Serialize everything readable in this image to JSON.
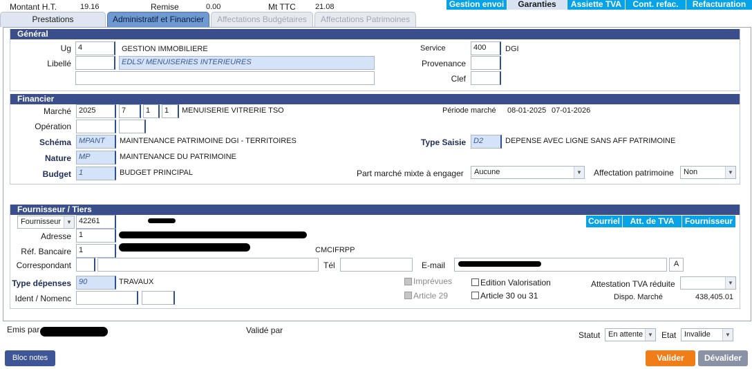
{
  "header": {
    "montant_ht_label": "Montant H.T.",
    "montant_ht_value": "19.16",
    "remise_label": "Remise",
    "remise_value": "0.00",
    "mt_ttc_label": "Mt TTC",
    "mt_ttc_value": "21.08",
    "top_buttons": [
      "Gestion envoi",
      "Garanties",
      "Assiette TVA",
      "Cont. refac.",
      "Refacturation"
    ]
  },
  "tabs": [
    "Prestations",
    "Administratif et Financier",
    "Affectations Budgétaires",
    "Affectations Patrimoines"
  ],
  "general": {
    "title": "Général",
    "ug_label": "Ug",
    "ug_value": "4",
    "ug_text": "GESTION IMMOBILIERE",
    "service_label": "Service",
    "service_value": "400",
    "service_text": "DGI",
    "libelle_label": "Libellé",
    "libelle_value": "EDLS/ MENUISERIES INTERIEURES",
    "provenance_label": "Provenance",
    "clef_label": "Clef"
  },
  "financier": {
    "title": "Financier",
    "marche_label": "Marché",
    "marche_year": "2025",
    "marche_n1": "7",
    "marche_n2": "1",
    "marche_n3": "1",
    "marche_text": "MENUISERIE VITRERIE TSO",
    "periode_label": "Période marché",
    "periode_start": "08-01-2025",
    "periode_end": "07-01-2026",
    "operation_label": "Opération",
    "schema_label": "Schéma",
    "schema_value": "MPANT",
    "schema_text": "MAINTENANCE PATRIMOINE DGI - TERRITOIRES",
    "type_saisie_label": "Type Saisie",
    "type_saisie_value": "D2",
    "type_saisie_text": "DEPENSE AVEC LIGNE SANS AFF PATRIMOINE",
    "nature_label": "Nature",
    "nature_value": "MP",
    "nature_text": "MAINTENANCE DU PATRIMOINE",
    "budget_label": "Budget",
    "budget_value": "1",
    "budget_text": "BUDGET PRINCIPAL",
    "part_marche_label": "Part marché mixte à engager",
    "part_marche_value": "Aucune",
    "affectation_label": "Affectation patrimoine",
    "affectation_value": "Non"
  },
  "fournisseur": {
    "title": "Fournisseur / Tiers",
    "type_value": "Fournisseur",
    "code_value": "42261",
    "buttons": [
      "Courriel",
      "Att. de TVA",
      "Fournisseur"
    ],
    "adresse_label": "Adresse",
    "adresse_value": "1",
    "ref_bancaire_label": "Réf. Bancaire",
    "ref_bancaire_value": "1",
    "ref_bancaire_text": "CMCIFRPP",
    "correspondant_label": "Correspondant",
    "tel_label": "Tél",
    "email_label": "E-mail",
    "email_btn": "A",
    "type_depenses_label": "Type dépenses",
    "type_depenses_value": "90",
    "type_depenses_text": "TRAVAUX",
    "ident_label": "Ident / Nomenc",
    "imprevues_label": "Imprévues",
    "article29_label": "Article 29",
    "edition_label": "Edition Valorisation",
    "article30_label": "Article 30 ou 31",
    "attestation_label": "Attestation TVA réduite",
    "dispo_label": "Dispo. Marché",
    "dispo_value": "438,405.01"
  },
  "footer": {
    "emis_label": "Emis par",
    "valide_label": "Validé par",
    "statut_label": "Statut",
    "statut_value": "En attente",
    "etat_label": "Etat",
    "etat_value": "Invalide",
    "bloc_notes": "Bloc notes",
    "valider": "Valider",
    "devalider": "Dévalider"
  },
  "colors": {
    "section_header": "#3a4e8c",
    "top_button": "#06a3e6",
    "valider": "#f07d18",
    "devalider": "#8a93a6",
    "bloc_notes": "#3e5597"
  }
}
